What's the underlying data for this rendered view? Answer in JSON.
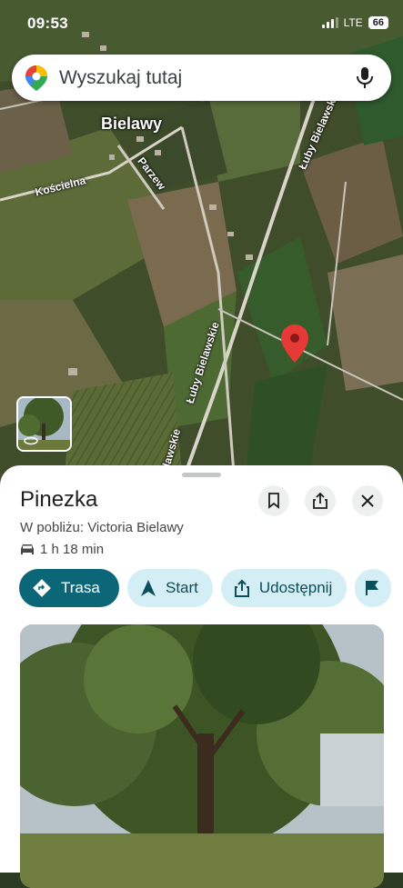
{
  "status_bar": {
    "time": "09:53",
    "network": "LTE",
    "battery": "66"
  },
  "search": {
    "placeholder": "Wyszukaj tutaj"
  },
  "map": {
    "labels": {
      "village": "Bielawy",
      "street_1": "Kościelna",
      "street_2": "Parzew",
      "road_1": "Łuby Bielawskie",
      "road_2": "Łuby Bielawskie",
      "road_3": "Łuby Bielawskie"
    },
    "pin_color": "#e53935"
  },
  "place": {
    "title": "Pinezka",
    "nearby": "W pobliżu: Victoria Bielawy",
    "drive_time": "1 h 18 min",
    "actions": [
      {
        "label": "Trasa",
        "icon": "directions-icon"
      },
      {
        "label": "Start",
        "icon": "navigation-arrow-icon"
      },
      {
        "label": "Udostępnij",
        "icon": "share-icon"
      }
    ],
    "header_buttons": [
      "bookmark-icon",
      "share-icon",
      "close-icon"
    ]
  },
  "colors": {
    "primary_chip": "#0b6777",
    "secondary_chip": "#d3eef4"
  }
}
